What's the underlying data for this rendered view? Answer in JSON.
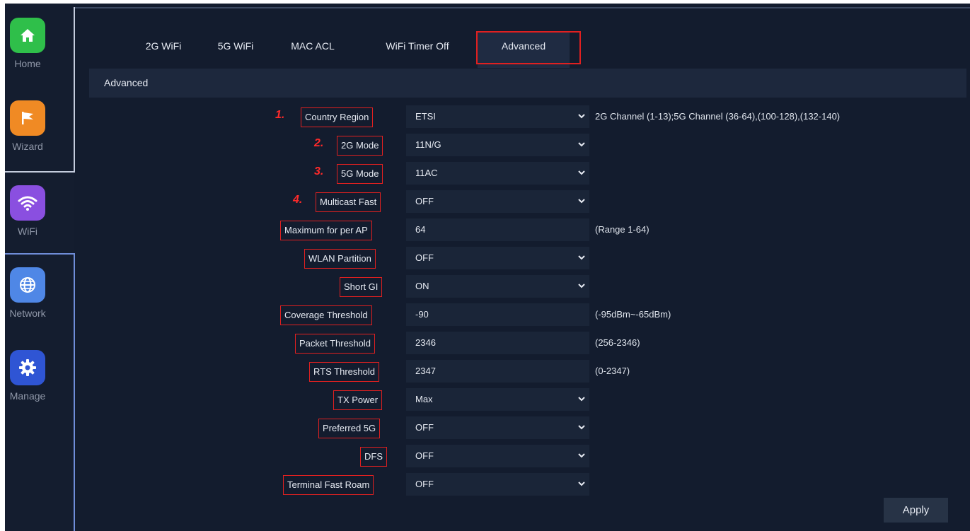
{
  "sidebar": {
    "items": [
      {
        "label": "Home",
        "icon": "home-icon",
        "color": "#2fbf4a"
      },
      {
        "label": "Wizard",
        "icon": "flag-icon",
        "color": "#f08a24"
      },
      {
        "label": "WiFi",
        "icon": "wifi-icon",
        "color": "#8a4fe0"
      },
      {
        "label": "Network",
        "icon": "globe-icon",
        "color": "#4f87e6"
      },
      {
        "label": "Manage",
        "icon": "gear-icon",
        "color": "#2f55d4"
      }
    ]
  },
  "tabs": {
    "t1": "2G WiFi",
    "t2": "5G WiFi",
    "t3": "MAC ACL",
    "t4": "WiFi Timer Off",
    "t5": "Advanced"
  },
  "section_title": "Advanced",
  "fields": {
    "country_region": {
      "num": "1.",
      "label": "Country Region",
      "value": "ETSI",
      "hint": "2G Channel (1-13);5G Channel (36-64),(100-128),(132-140)"
    },
    "mode_2g": {
      "num": "2.",
      "label": "2G Mode",
      "value": "11N/G"
    },
    "mode_5g": {
      "num": "3.",
      "label": "5G Mode",
      "value": "11AC"
    },
    "multicast_fast": {
      "num": "4.",
      "label": "Multicast Fast",
      "value": "OFF"
    },
    "max_per_ap": {
      "label": "Maximum for per AP",
      "value": "64",
      "hint": "(Range 1-64)"
    },
    "wlan_partition": {
      "label": "WLAN Partition",
      "value": "OFF"
    },
    "short_gi": {
      "label": "Short GI",
      "value": "ON"
    },
    "coverage_threshold": {
      "label": "Coverage Threshold",
      "value": "-90",
      "hint": "(-95dBm~-65dBm)"
    },
    "packet_threshold": {
      "label": "Packet Threshold",
      "value": "2346",
      "hint": "(256-2346)"
    },
    "rts_threshold": {
      "label": "RTS Threshold",
      "value": "2347",
      "hint": "(0-2347)"
    },
    "tx_power": {
      "label": "TX Power",
      "value": "Max"
    },
    "preferred_5g": {
      "label": "Preferred 5G",
      "value": "OFF"
    },
    "dfs": {
      "label": "DFS",
      "value": "OFF"
    },
    "terminal_fast_roam": {
      "label": "Terminal Fast Roam",
      "value": "OFF"
    }
  },
  "apply_label": "Apply",
  "colors": {
    "accent_red": "#e02020",
    "background": "#131c2e"
  }
}
